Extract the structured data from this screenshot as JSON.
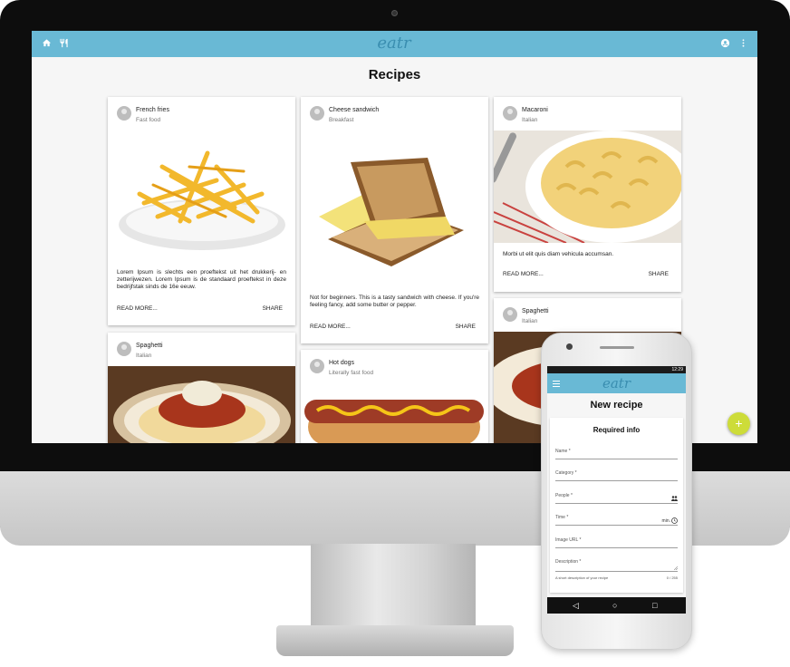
{
  "desktop": {
    "app_logo": "eatr",
    "page_title": "Recipes",
    "fab_label": "+",
    "cards": [
      {
        "title": "French fries",
        "category": "Fast food",
        "text": "Lorem Ipsum is slechts een proeftekst uit het drukkerij- en zetterijwezen. Lorem Ipsum is de standaard proeftekst in deze bedrijfstak sinds de 16e eeuw.",
        "read_more": "READ MORE...",
        "share": "SHARE"
      },
      {
        "title": "Cheese sandwich",
        "category": "Breakfast",
        "text": "Not for beginners. This is a tasty sandwich with cheese. If you're feeling fancy, add some butter or pepper.",
        "read_more": "READ MORE...",
        "share": "SHARE"
      },
      {
        "title": "Macaroni",
        "category": "Italian",
        "text": "Morbi ut elit quis diam vehicula accumsan.",
        "read_more": "READ MORE...",
        "share": "SHARE"
      },
      {
        "title": "Spaghetti",
        "category": "Italian"
      },
      {
        "title": "Hot dogs",
        "category": "Literally fast food"
      },
      {
        "title": "Spaghetti",
        "category": "Italian"
      }
    ]
  },
  "mobile": {
    "status_time": "12:29",
    "app_logo": "eatr",
    "page_title": "New recipe",
    "section_title": "Required info",
    "fields": {
      "name": "Name *",
      "category": "Category *",
      "people": "People *",
      "time": "Time *",
      "time_suffix": "min.",
      "image_url": "Image URL *",
      "description": "Description *",
      "description_hint": "A short description of your recipe",
      "description_count": "0 / 255"
    },
    "nav": {
      "back": "◁",
      "home": "○",
      "recents": "□"
    }
  },
  "icons": {
    "home": "home-icon",
    "restaurant": "restaurant-icon",
    "account": "account-circle-icon",
    "more": "more-vert-icon",
    "menu": "menu-icon"
  },
  "colors": {
    "appbar": "#69b9d5",
    "fab": "#cddc39",
    "logo": "#3a8eb0"
  }
}
